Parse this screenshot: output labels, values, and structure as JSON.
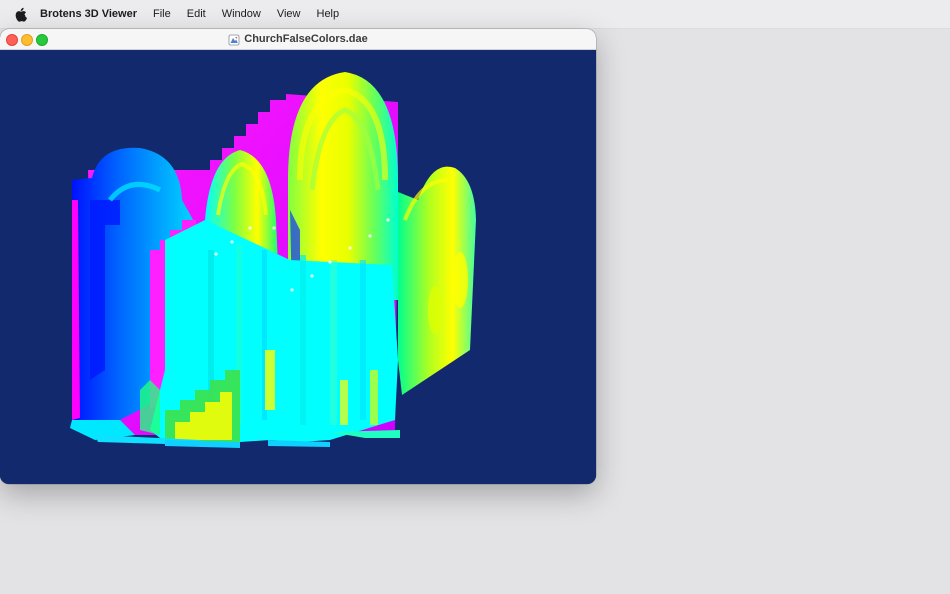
{
  "menubar": {
    "apple_icon": "apple-logo-icon",
    "app_name": "Brotens 3D Viewer",
    "items": [
      "File",
      "Edit",
      "Window",
      "View",
      "Help"
    ]
  },
  "window": {
    "title": "ChurchFalseColors.dae",
    "title_icon": "dae-document-icon",
    "viewport_background": "#12296e",
    "model_palette": [
      "#ff00ff",
      "#00ffff",
      "#00a0ff",
      "#ffff00",
      "#00ff80",
      "#1a1aff"
    ]
  },
  "colors": {
    "desktop": "#e3e3e6",
    "close": "#fe5f57",
    "minimize": "#febc2e",
    "maximize": "#28c840"
  }
}
